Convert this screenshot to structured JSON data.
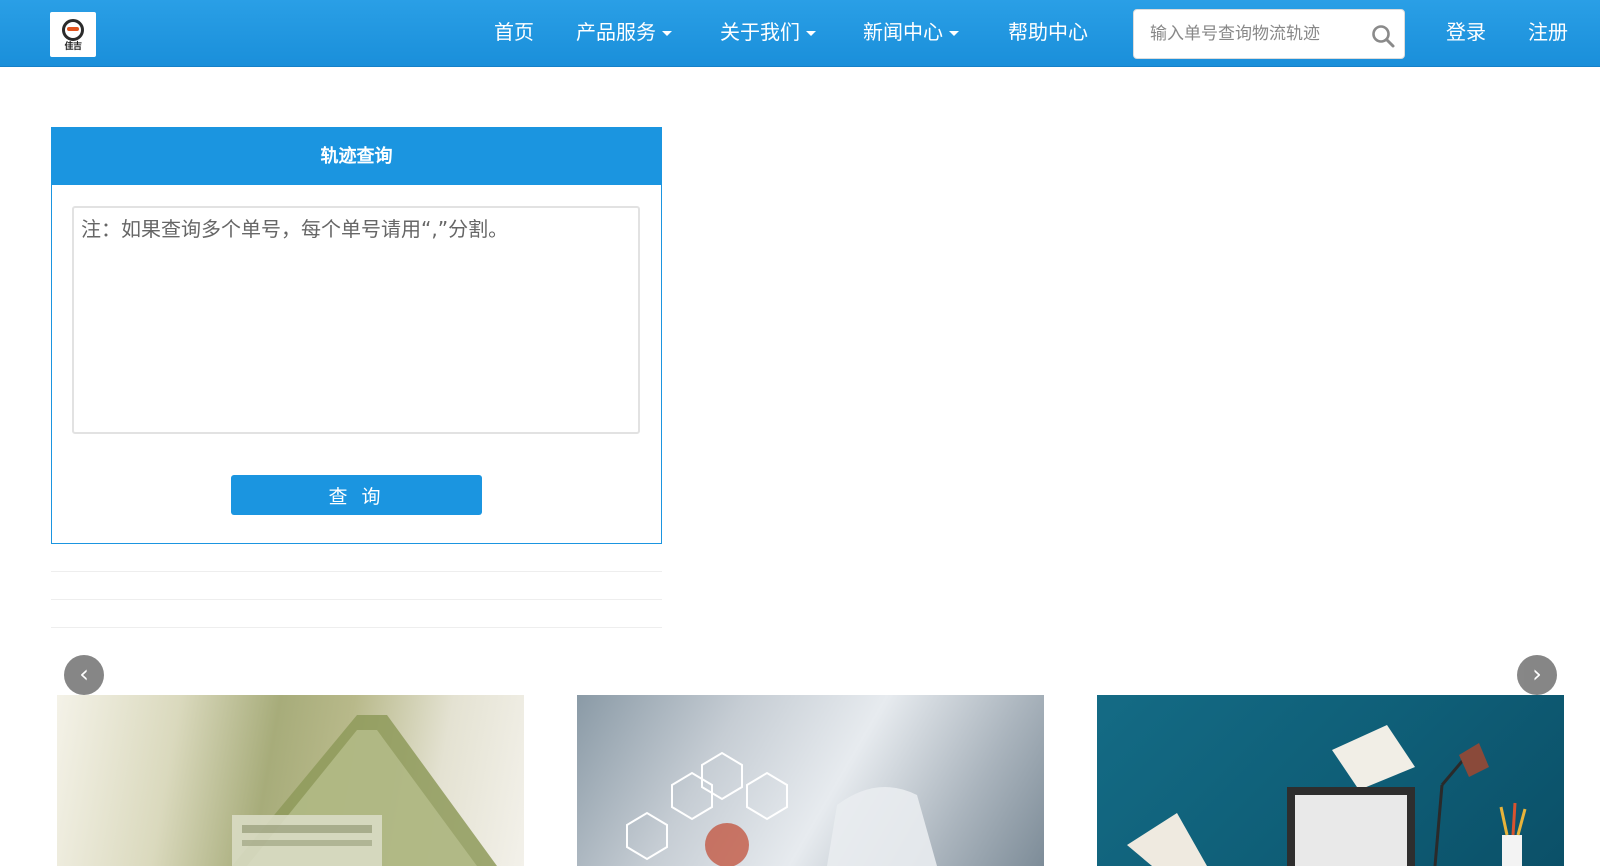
{
  "header": {
    "logo_text": "佳吉",
    "nav": {
      "home": "首页",
      "products": "产品服务",
      "about": "关于我们",
      "news": "新闻中心",
      "help": "帮助中心"
    },
    "search_placeholder": "输入单号查询物流轨迹",
    "login": "登录",
    "register": "注册"
  },
  "track_panel": {
    "title": "轨迹查询",
    "textarea_placeholder": "注：如果查询多个单号，每个单号请用“,”分割。",
    "button_label": "查 询"
  },
  "carousel": {
    "prev_symbol": "‹",
    "next_symbol": "›",
    "slides": [
      "money-house-image",
      "medical-tech-image",
      "desk-laptop-image"
    ]
  },
  "colors": {
    "brand_blue": "#1b95e0",
    "nav_blue": "#2a9fe6"
  }
}
